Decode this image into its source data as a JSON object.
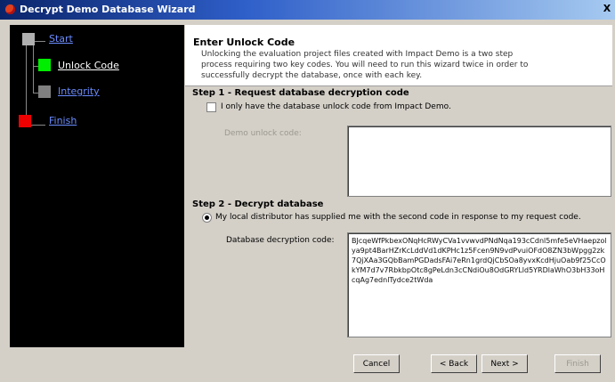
{
  "window": {
    "title": "Decrypt Demo Database Wizard",
    "close_label": "X"
  },
  "steps": [
    {
      "label": "Start",
      "color": "#b0b0b0"
    },
    {
      "label": "Unlock Code",
      "color": "#00ee00"
    },
    {
      "label": "Integrity",
      "color": "#808080"
    },
    {
      "label": "Finish",
      "color": "#ee0000"
    }
  ],
  "header": {
    "title": "Enter Unlock Code",
    "description": "Unlocking the evaluation project files created with Impact Demo is a two step process requiring two key codes.  You will need to run this wizard twice in order to successfully decrypt the database, once with each key."
  },
  "step1": {
    "title": "Step 1 - Request database decryption code",
    "checkbox_label": "I only have the database unlock code from Impact Demo.",
    "field_label": "Demo unlock code:",
    "field_value": ""
  },
  "step2": {
    "title": "Step 2 - Decrypt database",
    "radio_label": "My local distributor has supplied me with the second code in response to my request code.",
    "field_label": "Database decryption code:",
    "field_value": "BJcqeWfPkbexONqHcRWyCVa1vvwvdPNdNqa193cCdnl5mfe5eVHaepzolya9pt4BarHZrKcLddVd1dKPHc1z5Fcen9N9vdPvuiOFdO8ZN3bWpgg2zk7QjXAa3GQbBamPGDadsFAi7eRn1grdQjCbSOa8yvxKcdHjuOab9f25CcOkYM7d7v7RbkbpOtc8gPeLdn3cCNdiOu8OdGRYLld5YRDlaWhO3bH33oHcqAg7ednlTydce2tWda"
  },
  "buttons": {
    "cancel": "Cancel",
    "back": "< Back",
    "next": "Next >",
    "finish": "Finish"
  }
}
